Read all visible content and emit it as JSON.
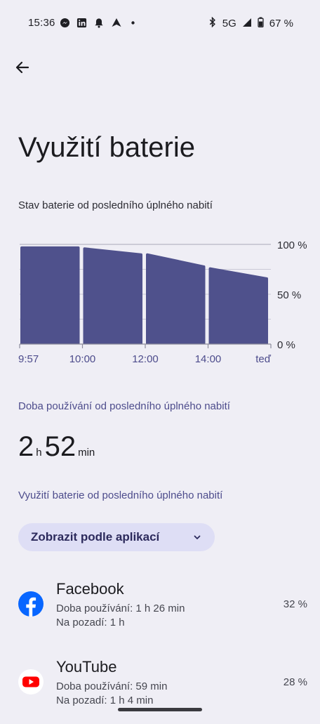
{
  "status_bar": {
    "time": "15:36",
    "left_icons": [
      "messenger-icon",
      "linkedin-icon",
      "bell-icon",
      "navigation-icon",
      "dot-icon"
    ],
    "network": "5G",
    "battery": "67 %"
  },
  "header": {
    "title": "Využití baterie",
    "subtitle": "Stav baterie od posledního úplného nabití"
  },
  "chart_data": {
    "type": "bar",
    "categories": [
      "9:57–10:00",
      "10:00–12:00",
      "12:00–14:00",
      "14:00–teď"
    ],
    "x_tick_labels": [
      "9:57",
      "10:00",
      "12:00",
      "14:00",
      "teď"
    ],
    "y_tick_labels": [
      "100 %",
      "50 %",
      "0 %"
    ],
    "ylim": [
      0,
      100
    ],
    "series": [
      {
        "values_start": [
          98,
          97,
          91,
          77
        ],
        "values_end": [
          98,
          91,
          79,
          67
        ]
      }
    ],
    "bar_color": "#4F518C",
    "grid": true
  },
  "usage": {
    "label": "Doba používání od posledního úplného nabití",
    "hours": "2",
    "hours_unit": "h",
    "minutes": "52",
    "minutes_unit": "min"
  },
  "battery_usage": {
    "label": "Využití baterie od posledního úplného nabití",
    "dropdown": "Zobrazit podle aplikací"
  },
  "apps": [
    {
      "name": "Facebook",
      "icon": "facebook-icon",
      "line1": "Doba používání: 1 h 26 min",
      "line2": "Na pozadí: 1 h",
      "percent": "32 %"
    },
    {
      "name": "YouTube",
      "icon": "youtube-icon",
      "line1": "Doba používání: 59 min",
      "line2": "Na pozadí: 1 h 4 min",
      "percent": "28 %"
    }
  ]
}
